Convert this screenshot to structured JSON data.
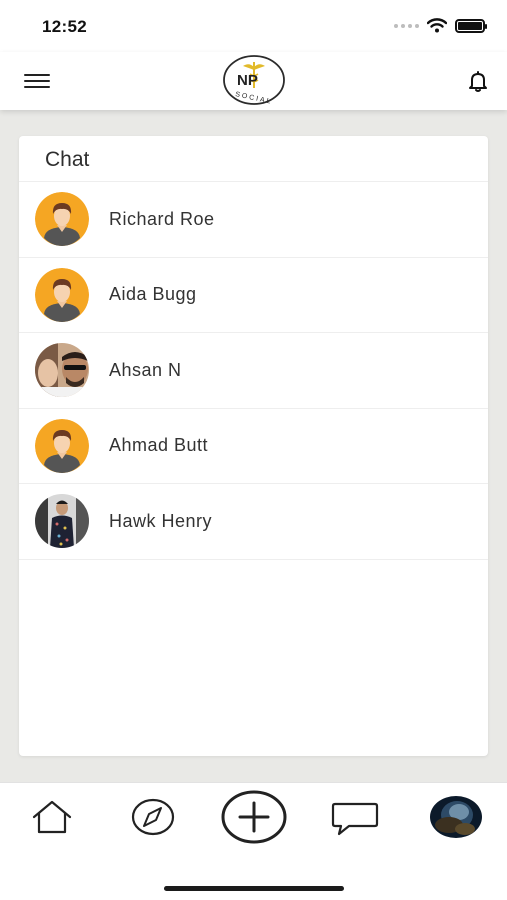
{
  "status_bar": {
    "time": "12:52",
    "icons": [
      "signal-dots-icon",
      "wifi-icon",
      "battery-icon"
    ]
  },
  "header": {
    "logo_text": "NP",
    "logo_subtext": "SOCIAL",
    "left_icon": "hamburger-menu-icon",
    "right_icon": "notification-bell-icon"
  },
  "chat": {
    "title": "Chat",
    "contacts": [
      {
        "name": "Richard Roe",
        "avatar": "default-avatar-icon"
      },
      {
        "name": "Aida Bugg",
        "avatar": "default-avatar-icon"
      },
      {
        "name": "Ahsan N",
        "avatar": "photo-avatar"
      },
      {
        "name": "Ahmad Butt",
        "avatar": "default-avatar-icon"
      },
      {
        "name": "Hawk Henry",
        "avatar": "photo-avatar"
      }
    ]
  },
  "bottom_nav": {
    "items": [
      "home-icon",
      "explore-compass-icon",
      "add-post-icon",
      "messages-icon",
      "profile-avatar"
    ]
  },
  "colors": {
    "background": "#e9e9e6",
    "card": "#ffffff",
    "avatar_orange": "#f5a623",
    "logo_gold": "#e2ba2a"
  }
}
